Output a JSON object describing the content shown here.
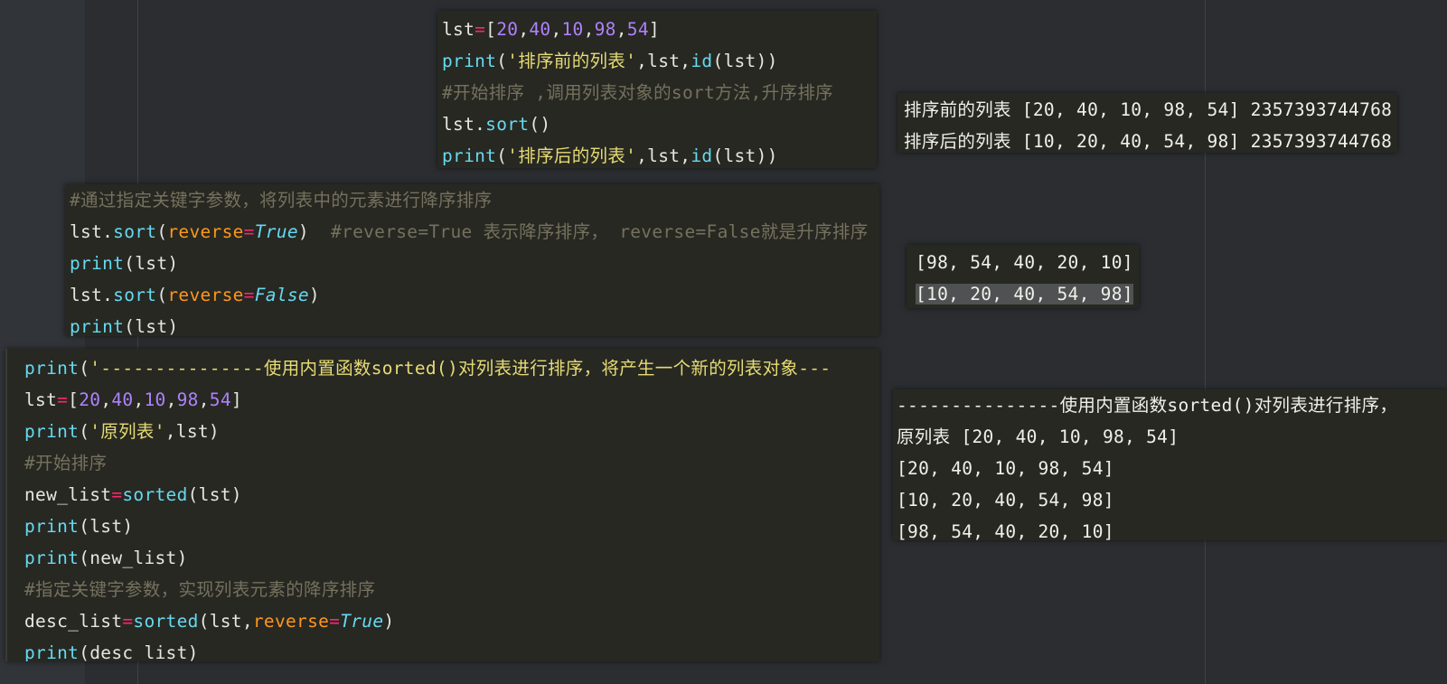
{
  "colors": {
    "editor_bg": "#272822",
    "builtin": "#66d9ef",
    "string": "#e6db74",
    "number": "#ae81ff",
    "operator": "#f92672",
    "keyword_arg": "#fd971f",
    "comment": "#75715e"
  },
  "code1": {
    "l1": {
      "a": "lst",
      "b": "=",
      "c": "[",
      "n1": "20",
      "s1": ",",
      "n2": "40",
      "s2": ",",
      "n3": "10",
      "s3": ",",
      "n4": "98",
      "s4": ",",
      "n5": "54",
      "d": "]"
    },
    "l2": {
      "fn": "print",
      "a": "(",
      "str": "'排序前的列表'",
      "b": ",lst,",
      "fn2": "id",
      "c": "(lst))"
    },
    "l3": {
      "cm": "#开始排序 ,调用列表对象的sort方法,升序排序"
    },
    "l4": {
      "a": "lst.",
      "fn": "sort",
      "b": "()"
    },
    "l5": {
      "fn": "print",
      "a": "(",
      "str": "'排序后的列表'",
      "b": ",lst,",
      "fn2": "id",
      "c": "(lst))"
    }
  },
  "out1": {
    "lines": [
      "排序前的列表 [20, 40, 10, 98, 54] 2357393744768",
      "排序后的列表 [10, 20, 40, 54, 98] 2357393744768"
    ]
  },
  "code2": {
    "l1": {
      "cm": "#通过指定关键字参数，将列表中的元素进行降序排序"
    },
    "l2": {
      "a": "lst.",
      "fn": "sort",
      "b": "(",
      "kw": "reverse",
      "op": "=",
      "bool": "True",
      "c": ")  ",
      "cm": "#reverse=True 表示降序排序， reverse=False就是升序排序"
    },
    "l3": {
      "fn": "print",
      "a": "(lst)"
    },
    "l4": {
      "a": "lst.",
      "fn": "sort",
      "b": "(",
      "kw": "reverse",
      "op": "=",
      "bool": "False",
      "c": ")"
    },
    "l5": {
      "fn": "print",
      "a": "(lst)"
    }
  },
  "out2": {
    "lines": [
      "[98, 54, 40, 20, 10]",
      "[10, 20, 40, 54, 98]"
    ]
  },
  "code3": {
    "l1": {
      "fn": "print",
      "a": "(",
      "str": "'---------------使用内置函数sorted()对列表进行排序，将产生一个新的列表对象---"
    },
    "l2": {
      "a": "lst",
      "b": "=",
      "c": "[",
      "n1": "20",
      "s1": ",",
      "n2": "40",
      "s2": ",",
      "n3": "10",
      "s3": ",",
      "n4": "98",
      "s4": ",",
      "n5": "54",
      "d": "]"
    },
    "l3": {
      "fn": "print",
      "a": "(",
      "str": "'原列表'",
      "b": ",lst)"
    },
    "l4": {
      "cm": "#开始排序"
    },
    "l5": {
      "a": "new_list",
      "op": "=",
      "fn": "sorted",
      "b": "(lst)"
    },
    "l6": {
      "fn": "print",
      "a": "(lst)"
    },
    "l7": {
      "fn": "print",
      "a": "(new_list)"
    },
    "l8": {
      "cm": "#指定关键字参数，实现列表元素的降序排序"
    },
    "l9": {
      "a": "desc_list",
      "op": "=",
      "fn": "sorted",
      "b": "(lst,",
      "kw": "reverse",
      "op2": "=",
      "bool": "True",
      "c": ")"
    },
    "l10": {
      "fn": "print",
      "a": "(desc_list)"
    }
  },
  "out3": {
    "lines": [
      "---------------使用内置函数sorted()对列表进行排序，",
      "原列表 [20, 40, 10, 98, 54]",
      "[20, 40, 10, 98, 54]",
      "[10, 20, 40, 54, 98]",
      "[98, 54, 40, 20, 10]"
    ]
  }
}
